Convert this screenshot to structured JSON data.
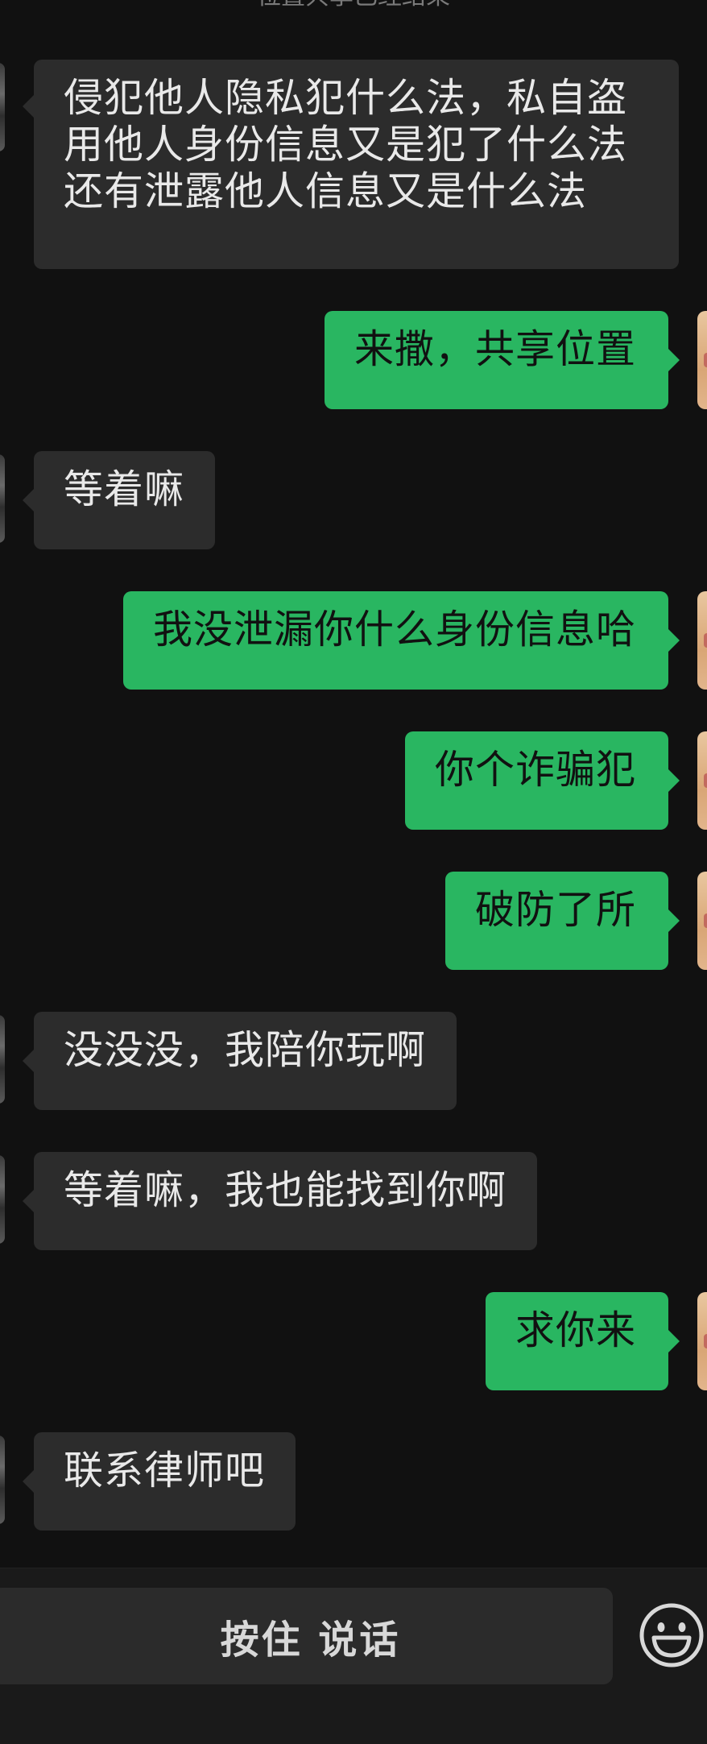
{
  "system_note": "位置共享已经结束",
  "messages": [
    {
      "side": "left",
      "lines": [
        "侵犯他人隐私犯什么法，私自盗",
        "用他人身份信息又是犯了什么法",
        "还有泄露他人信息又是什么法"
      ]
    },
    {
      "side": "right",
      "text": "来撒，共享位置"
    },
    {
      "side": "left",
      "text": "等着嘛"
    },
    {
      "side": "right",
      "text": "我没泄漏你什么身份信息哈"
    },
    {
      "side": "right",
      "text": "你个诈骗犯"
    },
    {
      "side": "right",
      "text": "破防了所"
    },
    {
      "side": "left",
      "text": "没没没，我陪你玩啊"
    },
    {
      "side": "left",
      "text": "等着嘛，我也能找到你啊"
    },
    {
      "side": "right",
      "text": "求你来"
    },
    {
      "side": "left",
      "text": "联系律师吧"
    }
  ],
  "input_bar": {
    "hold_to_talk": "按住 说话",
    "emoji_icon": "smiley-face-icon"
  },
  "colors": {
    "background": "#111111",
    "incoming_bubble": "#2c2c2c",
    "outgoing_bubble": "#29b661"
  }
}
